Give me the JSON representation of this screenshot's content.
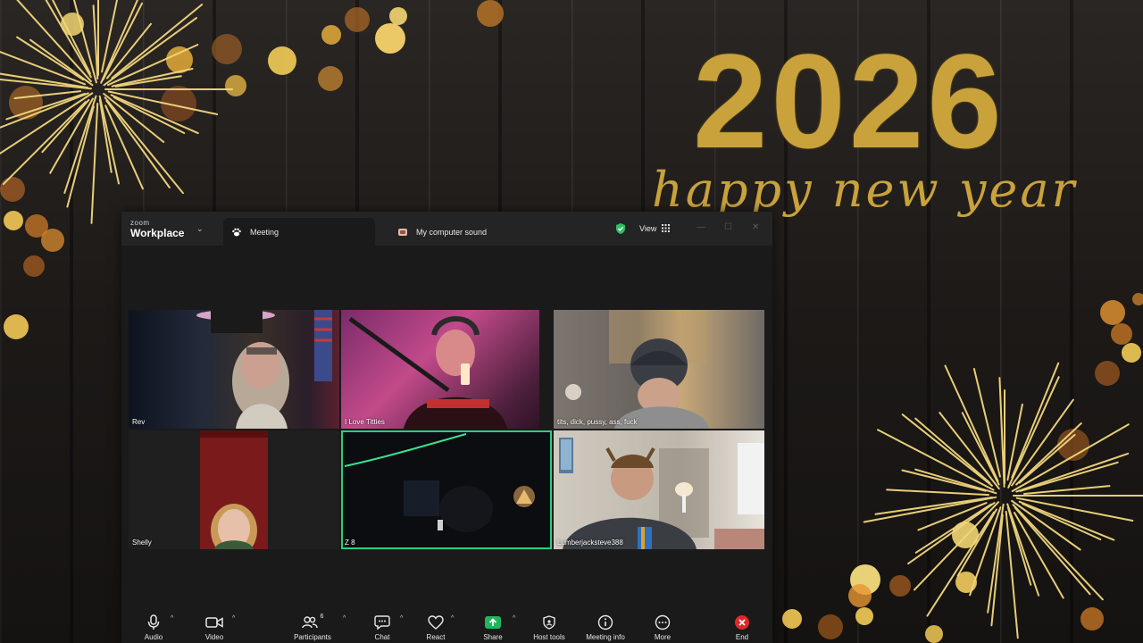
{
  "background": {
    "year": "2026",
    "greeting": "happy new year",
    "accent_gold": "#c9a23c"
  },
  "zoom": {
    "brand_top": "zoom",
    "brand_bottom": "Workplace",
    "tabs": [
      {
        "label": "Meeting",
        "icon": "paw-icon",
        "active": true
      },
      {
        "label": "My computer sound",
        "icon": "speaker-icon",
        "active": false
      }
    ],
    "view_label": "View",
    "participants": [
      {
        "name": "Rev"
      },
      {
        "name": "I Love Titties"
      },
      {
        "name": "tits, dick, pussy, ass, fuck"
      },
      {
        "name": "Shelly"
      },
      {
        "name": "Z 8",
        "speaking": true
      },
      {
        "name": "Lumberjacksteve388"
      }
    ],
    "toolbar": {
      "audio": "Audio",
      "video": "Video",
      "participants": "Participants",
      "participants_count": "6",
      "chat": "Chat",
      "react": "React",
      "share": "Share",
      "host_tools": "Host tools",
      "meeting_info": "Meeting info",
      "more": "More",
      "end": "End"
    },
    "colors": {
      "speaking_border": "#24d17e",
      "share_green": "#22b35e",
      "end_red": "#e02828",
      "shield_green": "#2fbf60"
    }
  }
}
